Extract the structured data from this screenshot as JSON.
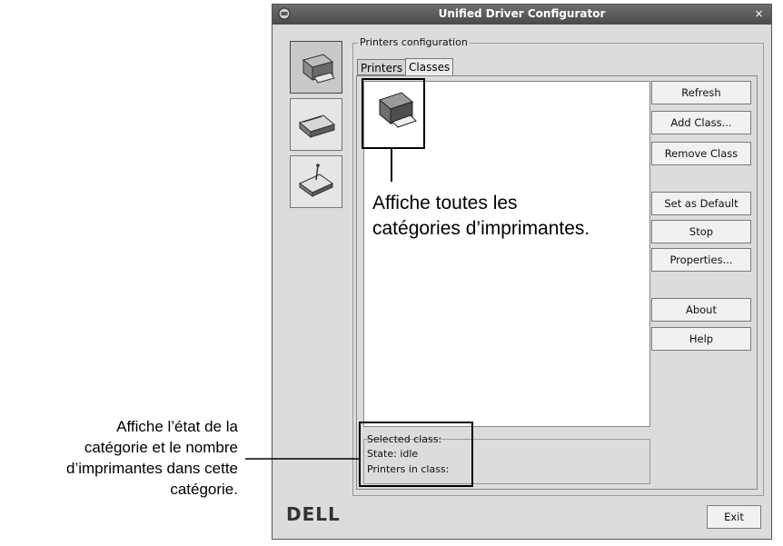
{
  "window": {
    "title": "Unified Driver Configurator",
    "close_glyph": "×"
  },
  "sidebar": {
    "items": [
      {
        "name": "printers",
        "icon": "printer-icon",
        "active": true
      },
      {
        "name": "scanners",
        "icon": "scanner-icon",
        "active": false
      },
      {
        "name": "ports",
        "icon": "port-icon",
        "active": false
      }
    ]
  },
  "group": {
    "label": "Printers configuration"
  },
  "tabs": [
    {
      "label": "Printers"
    },
    {
      "label": "Classes"
    }
  ],
  "buttons": {
    "refresh": "Refresh",
    "add_class": "Add Class...",
    "remove_class": "Remove Class",
    "set_default": "Set as Default",
    "stop": "Stop",
    "properties": "Properties...",
    "about": "About",
    "help": "Help",
    "exit": "Exit"
  },
  "status": {
    "selected_class": "Selected class:",
    "state": "State: idle",
    "printers_in_class": "Printers in class:"
  },
  "brand": {
    "logo": "DELL"
  },
  "annotations": {
    "classes_list": [
      "Affiche toutes les",
      "catégories d’imprimantes."
    ],
    "status_area": [
      "Affiche l’état de la",
      "catégorie et le nombre",
      "d’imprimantes dans cette",
      "catégorie."
    ]
  }
}
